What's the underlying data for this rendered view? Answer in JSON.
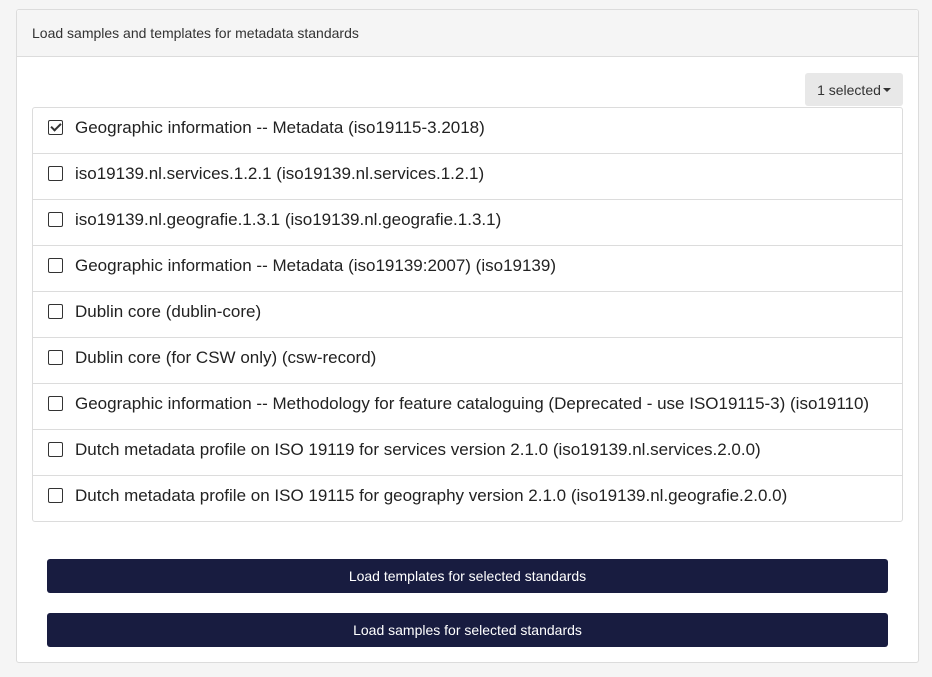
{
  "panel": {
    "heading": "Load samples and templates for metadata standards"
  },
  "dropdown": {
    "label": "1 selected"
  },
  "standards": [
    {
      "label": "Geographic information -- Metadata (iso19115-3.2018)",
      "checked": true
    },
    {
      "label": "iso19139.nl.services.1.2.1 (iso19139.nl.services.1.2.1)",
      "checked": false
    },
    {
      "label": "iso19139.nl.geografie.1.3.1 (iso19139.nl.geografie.1.3.1)",
      "checked": false
    },
    {
      "label": "Geographic information -- Metadata (iso19139:2007) (iso19139)",
      "checked": false
    },
    {
      "label": "Dublin core (dublin-core)",
      "checked": false
    },
    {
      "label": "Dublin core (for CSW only) (csw-record)",
      "checked": false
    },
    {
      "label": "Geographic information -- Methodology for feature cataloguing (Deprecated - use ISO19115-3) (iso19110)",
      "checked": false
    },
    {
      "label": "Dutch metadata profile on ISO 19119 for services version 2.1.0 (iso19139.nl.services.2.0.0)",
      "checked": false
    },
    {
      "label": "Dutch metadata profile on ISO 19115 for geography version 2.1.0 (iso19139.nl.geografie.2.0.0)",
      "checked": false
    }
  ],
  "buttons": {
    "load_templates": "Load templates for selected standards",
    "load_samples": "Load samples for selected standards"
  },
  "colors": {
    "primary_button": "#181c40",
    "panel_border": "#dcdcdc",
    "heading_bg": "#f5f5f5"
  }
}
